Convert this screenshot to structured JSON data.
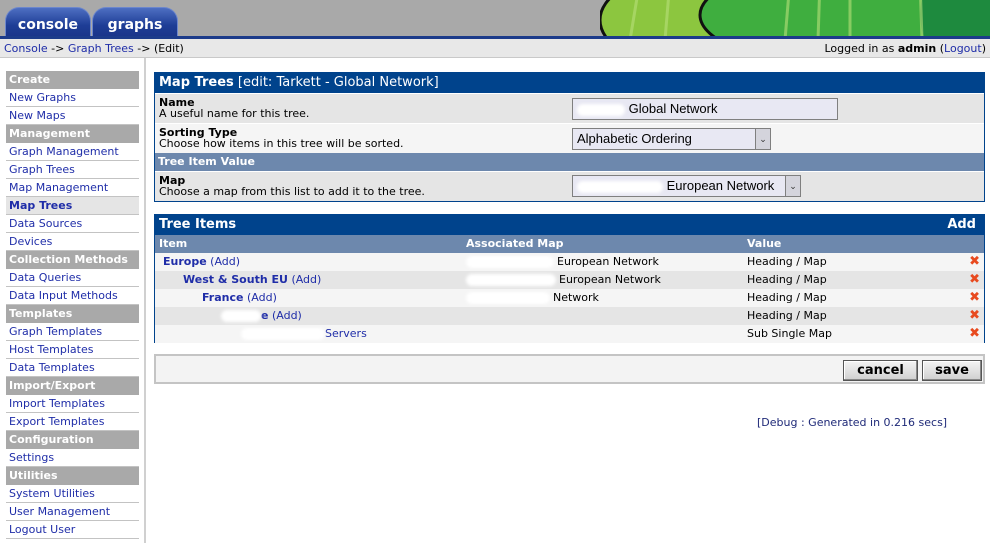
{
  "header": {
    "tabs": [
      {
        "label": "console"
      },
      {
        "label": "graphs"
      }
    ]
  },
  "breadcrumb": {
    "items": [
      "Console",
      "Graph Trees"
    ],
    "separator": "->",
    "current": "(Edit)"
  },
  "login": {
    "prefix": "Logged in as",
    "user": "admin",
    "logout_label": "Logout"
  },
  "sidebar": {
    "sections": [
      {
        "title": "Create",
        "items": [
          "New Graphs",
          "New Maps"
        ]
      },
      {
        "title": "Management",
        "items": [
          "Graph Management",
          "Graph Trees",
          "Map Management",
          "Map Trees",
          "Data Sources",
          "Devices"
        ]
      },
      {
        "title": "Collection Methods",
        "items": [
          "Data Queries",
          "Data Input Methods"
        ]
      },
      {
        "title": "Templates",
        "items": [
          "Graph Templates",
          "Host Templates",
          "Data Templates"
        ]
      },
      {
        "title": "Import/Export",
        "items": [
          "Import Templates",
          "Export Templates"
        ]
      },
      {
        "title": "Configuration",
        "items": [
          "Settings"
        ]
      },
      {
        "title": "Utilities",
        "items": [
          "System Utilities",
          "User Management",
          "Logout User"
        ]
      }
    ],
    "active_item": "Map Trees"
  },
  "form": {
    "title": "Map Trees",
    "title_suffix": "[edit: Tarkett - Global Network]",
    "name_label": "Name",
    "name_desc": "A useful name for this tree.",
    "name_value": "Global Network",
    "sort_label": "Sorting Type",
    "sort_desc": "Choose how items in this tree will be sorted.",
    "sort_value": "Alphabetic Ordering",
    "subhead": "Tree Item Value",
    "map_label": "Map",
    "map_desc": "Choose a map from this list to add it to the tree.",
    "map_value": "European Network"
  },
  "tree": {
    "title": "Tree Items",
    "add_label": "Add",
    "columns": [
      "Item",
      "Associated Map",
      "Value"
    ],
    "add_link": "(Add)",
    "rows": [
      {
        "item": "Europe",
        "map": "European Network",
        "value": "Heading / Map",
        "has_add": true
      },
      {
        "item": "West & South EU",
        "map": "European Network",
        "value": "Heading / Map",
        "has_add": true
      },
      {
        "item": "France",
        "map": "Network",
        "value": "Heading / Map",
        "has_add": true
      },
      {
        "item": "e",
        "map": "",
        "value": "Heading / Map",
        "has_add": true
      },
      {
        "item": "Servers",
        "map": "",
        "value": "Sub Single Map",
        "has_add": false
      }
    ]
  },
  "buttons": {
    "cancel": "cancel",
    "save": "save"
  },
  "debug": "[Debug : Generated in 0.216 secs]",
  "colors": {
    "panel_header": "#00438c",
    "subheader": "#6d88ad",
    "sidebar_head": "#a9a9a9",
    "link": "#1f2da8",
    "delete": "#e84a1f"
  }
}
